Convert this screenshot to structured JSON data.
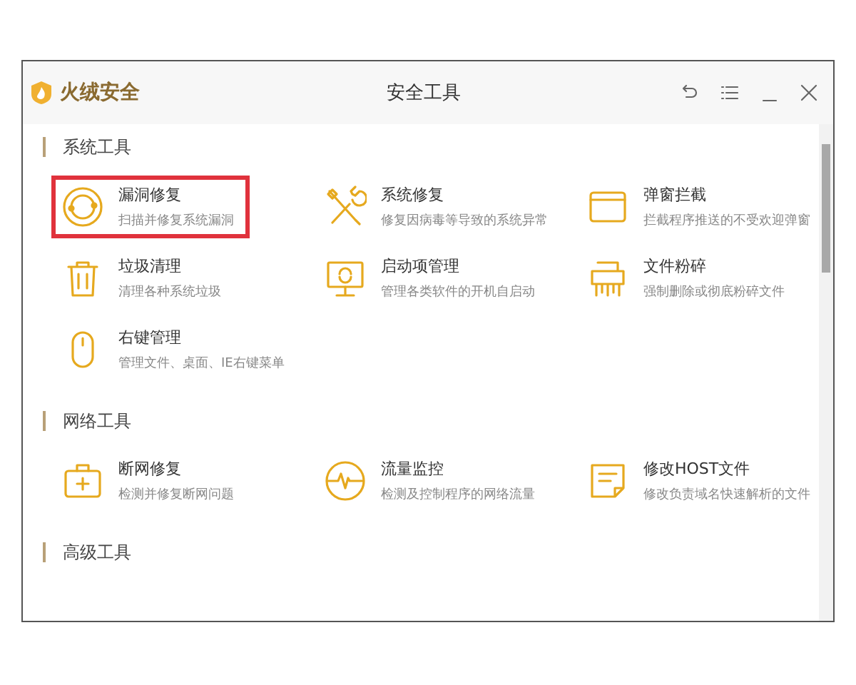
{
  "window": {
    "logo_text": "火绒安全",
    "title": "安全工具"
  },
  "sections": [
    {
      "title": "系统工具",
      "items": [
        {
          "name": "漏洞修复",
          "description": "扫描并修复系统漏洞",
          "highlighted": true
        },
        {
          "name": "系统修复",
          "description": "修复因病毒等导致的系统异常",
          "highlighted": false
        },
        {
          "name": "弹窗拦截",
          "description": "拦截程序推送的不受欢迎弹窗",
          "highlighted": false
        },
        {
          "name": "垃圾清理",
          "description": "清理各种系统垃圾",
          "highlighted": false
        },
        {
          "name": "启动项管理",
          "description": "管理各类软件的开机自启动",
          "highlighted": false
        },
        {
          "name": "文件粉碎",
          "description": "强制删除或彻底粉碎文件",
          "highlighted": false
        },
        {
          "name": "右键管理",
          "description": "管理文件、桌面、IE右键菜单",
          "highlighted": false
        }
      ]
    },
    {
      "title": "网络工具",
      "items": [
        {
          "name": "断网修复",
          "description": "检测并修复断网问题",
          "highlighted": false
        },
        {
          "name": "流量监控",
          "description": "检测及控制程序的网络流量",
          "highlighted": false
        },
        {
          "name": "修改HOST文件",
          "description": "修改负责域名快速解析的文件",
          "highlighted": false
        }
      ]
    },
    {
      "title": "高级工具"
    }
  ]
}
